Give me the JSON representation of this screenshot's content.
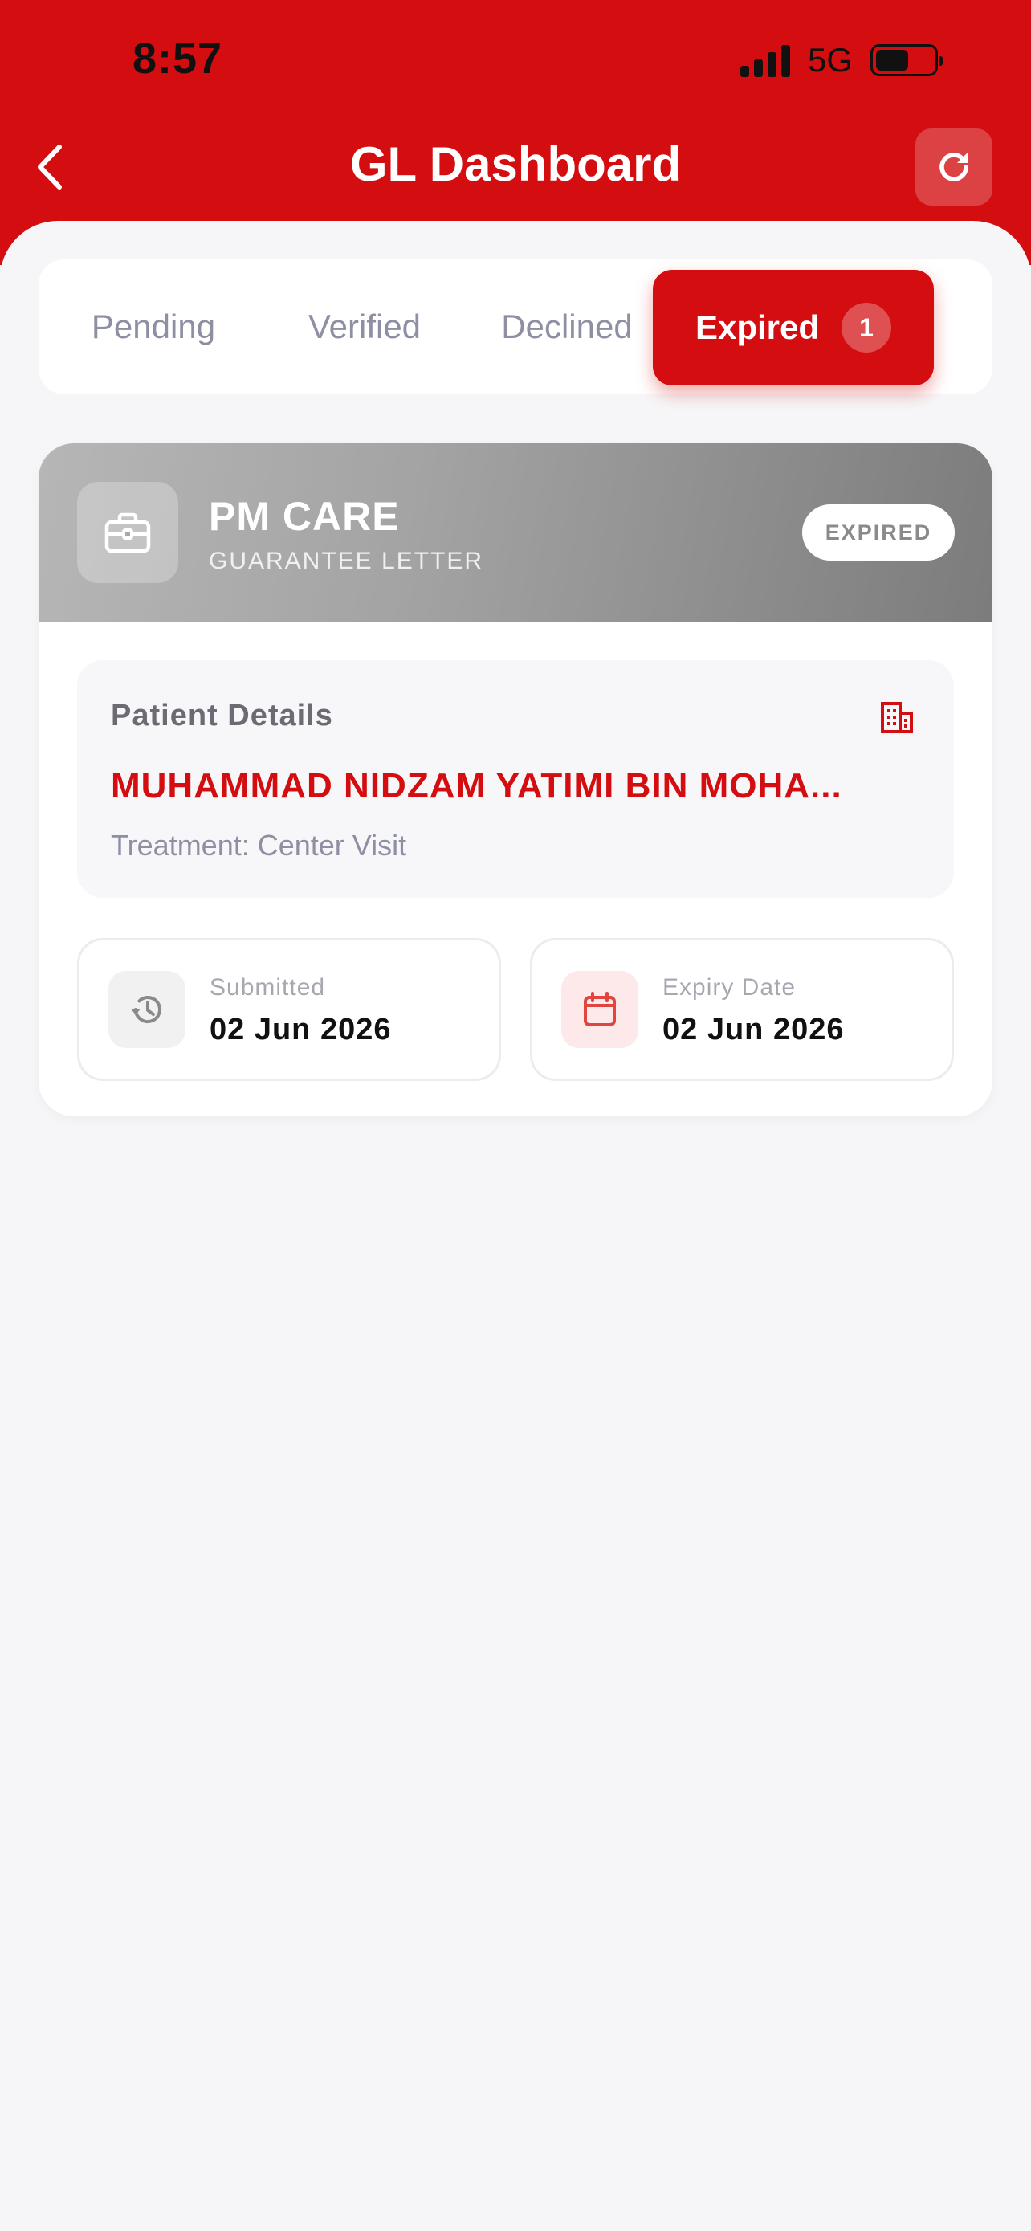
{
  "status_bar": {
    "time": "8:57",
    "network": "5G"
  },
  "header": {
    "title": "GL Dashboard"
  },
  "tabs": [
    {
      "label": "Pending"
    },
    {
      "label": "Verified"
    },
    {
      "label": "Declined"
    },
    {
      "label": "Expired",
      "badge": "1"
    }
  ],
  "card": {
    "title": "PM CARE",
    "subtitle": "GUARANTEE LETTER",
    "status": "EXPIRED",
    "patient_label": "Patient Details",
    "patient_name": "MUHAMMAD NIDZAM YATIMI BIN MOHA...",
    "treatment": "Treatment: Center Visit",
    "submitted_label": "Submitted",
    "submitted_value": "02 Jun 2026",
    "expiry_label": "Expiry Date",
    "expiry_value": "02 Jun 2026"
  },
  "colors": {
    "brand": "#d30d10",
    "muted": "#8e8fa3"
  }
}
